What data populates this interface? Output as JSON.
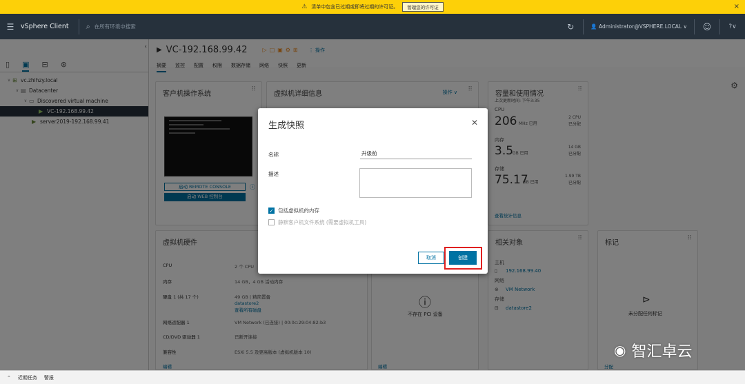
{
  "warning_bar": {
    "text": "清单中包含已过期或即将过期的许可证。",
    "button": "管理您的许可证",
    "close": "×"
  },
  "header": {
    "menu_icon": "menu-icon",
    "app_title": "vSphere Client",
    "search_placeholder": "在所有环境中搜索",
    "user": "Administrator@VSPHERE.LOCAL ∨",
    "help": "?∨"
  },
  "sidebar": {
    "tree": [
      {
        "label": "vc.zhihzy.local",
        "level": 0,
        "caret": "∨"
      },
      {
        "label": "Datacenter",
        "level": 1,
        "caret": "∨"
      },
      {
        "label": "Discovered virtual machine",
        "level": 2,
        "caret": "∨"
      },
      {
        "label": "VC-192.168.99.42",
        "level": 3,
        "caret": "",
        "selected": true
      },
      {
        "label": "server2019-192.168.99.41",
        "level": 3,
        "caret": ""
      }
    ]
  },
  "main": {
    "vm_title": "VC-192.168.99.42",
    "actions_label": "操作",
    "tabs": [
      "摘要",
      "监控",
      "配置",
      "权限",
      "数据存储",
      "网络",
      "快照",
      "更新"
    ],
    "cards": {
      "guest_os": {
        "title": "客户机操作系统",
        "btn_remote": "启动 REMOTE CONSOLE",
        "btn_web": "启动 WEB 控制台"
      },
      "vm_details": {
        "title": "虚拟机详细信息",
        "actions": "操作 ∨"
      },
      "capacity": {
        "title": "容量和使用情况",
        "updated": "上次更新时间: 下午3:35",
        "cpu_label": "CPU",
        "cpu_value": "206",
        "cpu_unit": "MHz 已用",
        "cpu_alloc": "2 CPU",
        "cpu_alloc_sub": "已分配",
        "mem_label": "内存",
        "mem_value": "3.5",
        "mem_unit": "GB 已用",
        "mem_alloc": "14 GB",
        "mem_alloc_sub": "已分配",
        "storage_label": "存储",
        "storage_value": "75.17",
        "storage_unit": "GB 已用",
        "storage_alloc": "1.99 TB",
        "storage_alloc_sub": "已分配",
        "link": "查看统计信息"
      },
      "hardware": {
        "title": "虚拟机硬件",
        "rows": [
          {
            "k": "CPU",
            "v": "2 个 CPU"
          },
          {
            "k": "内存",
            "v": "14 GB，4 GB 活动内存"
          },
          {
            "k": "硬盘 1 (共 17 个)",
            "v": "49 GB | 精简置备"
          },
          {
            "k": "",
            "v": "datastore2"
          },
          {
            "k": "",
            "v": "查看所有磁盘"
          },
          {
            "k": "网络适配器 1",
            "v": "VM Network (已连接) | 00:0c:29:04:82:b3"
          },
          {
            "k": "CD/DVD 驱动器 1",
            "v": "已断开连接"
          },
          {
            "k": "兼容性",
            "v": "ESXi 5.5 及更高版本 (虚拟机版本 10)"
          }
        ],
        "edit": "编辑"
      },
      "pci": {
        "text": "不存在 PCI 设备",
        "edit": "编辑"
      },
      "related": {
        "title": "相关对象",
        "host_label": "主机",
        "host": "192.168.99.40",
        "net_label": "网络",
        "net": "VM Network",
        "ds_label": "存储",
        "ds": "datastore2"
      },
      "tags": {
        "title": "标记",
        "empty": "未分配任何标记",
        "assign": "分配"
      }
    }
  },
  "dialog": {
    "title": "生成快照",
    "name_label": "名称",
    "name_value": "升级前",
    "desc_label": "描述",
    "desc_value": "",
    "include_memory": "包括虚拟机的内存",
    "quiesce": "静默客户机文件系统 (需要虚拟机工具)",
    "cancel": "取消",
    "create": "创建"
  },
  "bottom": {
    "recent_tasks": "近期任务",
    "alarms": "警报"
  },
  "watermark": {
    "text": "智汇卓云"
  }
}
